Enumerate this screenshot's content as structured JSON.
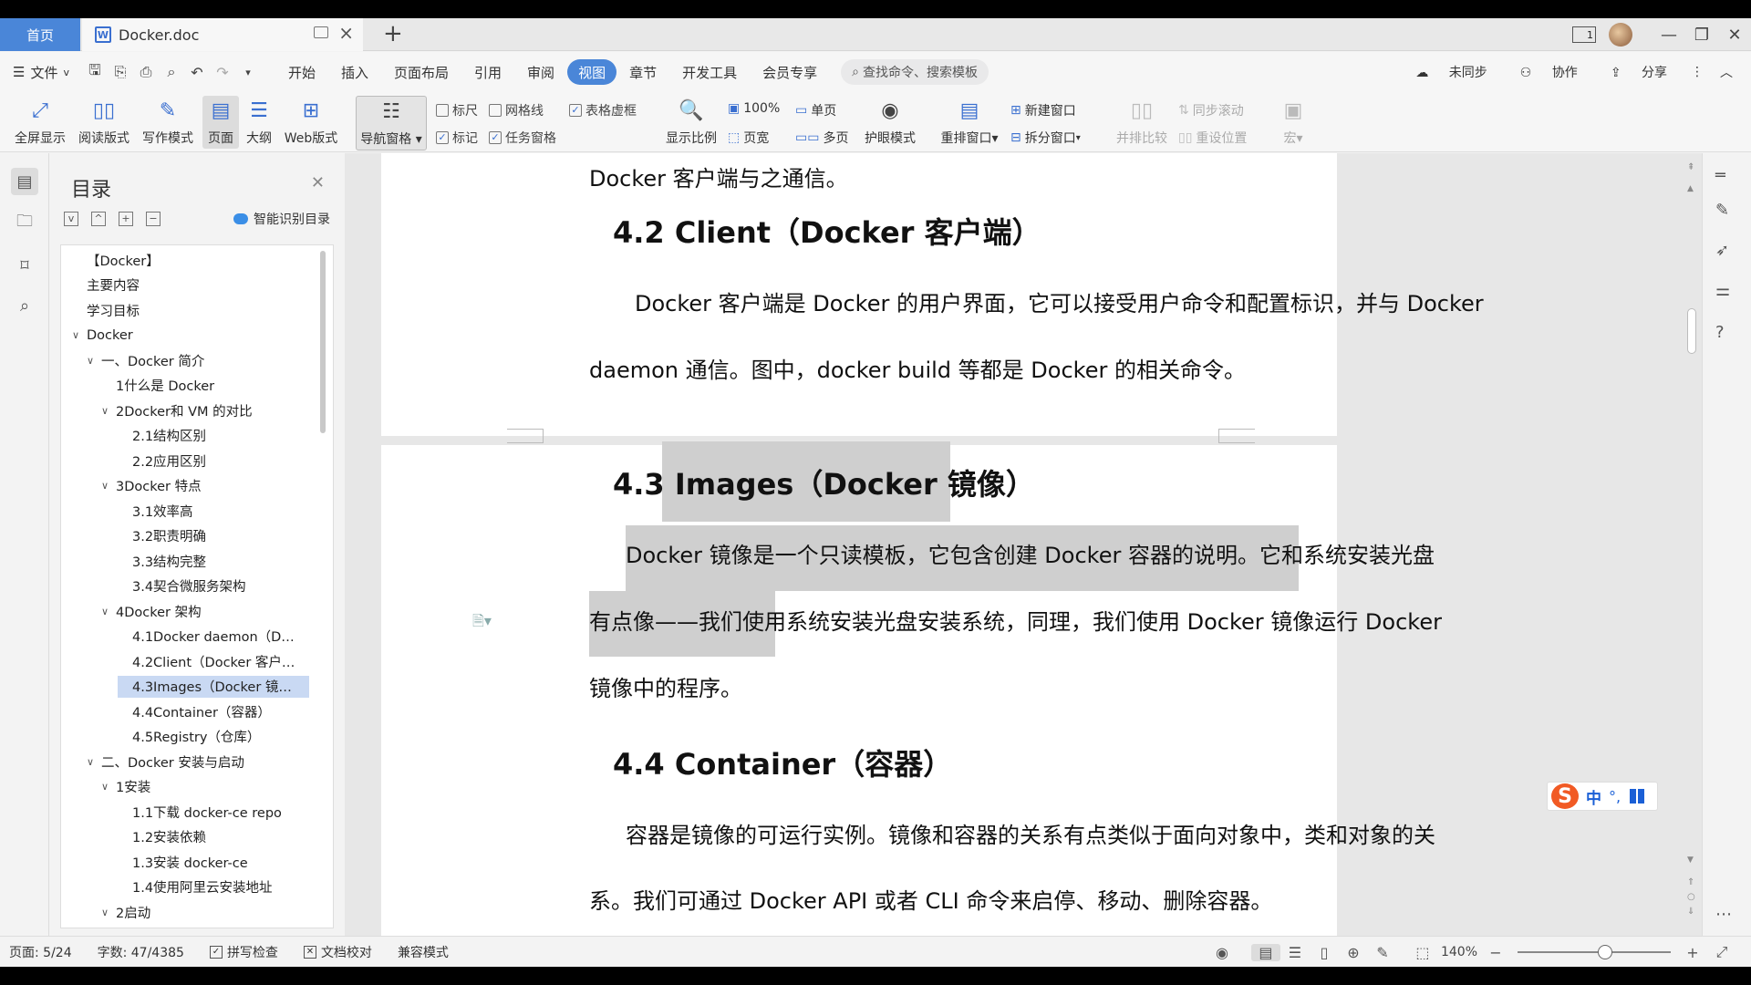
{
  "titlebar": {
    "home_tab": "首页",
    "doc_tab": "Docker.doc",
    "doc_icon": "W",
    "add_tab": "+",
    "page_num": "1"
  },
  "menubar": {
    "file": "文件",
    "items": [
      "开始",
      "插入",
      "页面布局",
      "引用",
      "审阅",
      "视图",
      "章节",
      "开发工具",
      "会员专享"
    ],
    "active": "视图",
    "search": "查找命令、搜索模板",
    "sync": "未同步",
    "collab": "协作",
    "share": "分享"
  },
  "ribbon": {
    "fullscreen": "全屏显示",
    "reading": "阅读版式",
    "writing": "写作模式",
    "page": "页面",
    "outline": "大纲",
    "web": "Web版式",
    "nav_pane": "导航窗格",
    "ruler": "标尺",
    "gridlines": "网格线",
    "table_grid": "表格虚框",
    "marks": "标记",
    "task_pane": "任务窗格",
    "zoom_ratio": "显示比例",
    "zoom_100": "100%",
    "page_width": "页宽",
    "single_page": "单页",
    "multi_page": "多页",
    "eye_protect": "护眼模式",
    "rearrange": "重排窗口",
    "new_window": "新建窗口",
    "split_window": "拆分窗口",
    "side_by_side": "并排比较",
    "sync_scroll": "同步滚动",
    "reset_pos": "重设位置",
    "macro": "宏"
  },
  "toc": {
    "title": "目录",
    "smart": "智能识别目录",
    "items": [
      {
        "text": "【Docker】",
        "level": 0,
        "caret": ""
      },
      {
        "text": "主要内容",
        "level": 0,
        "caret": ""
      },
      {
        "text": "学习目标",
        "level": 0,
        "caret": ""
      },
      {
        "text": "Docker",
        "level": 0,
        "caret": "v"
      },
      {
        "text": "一、Docker 简介",
        "level": 1,
        "caret": "v"
      },
      {
        "text": "1什么是 Docker",
        "level": 2,
        "caret": ""
      },
      {
        "text": "2Docker和 VM 的对比",
        "level": 2,
        "caret": "v"
      },
      {
        "text": "2.1结构区别",
        "level": 3,
        "caret": ""
      },
      {
        "text": "2.2应用区别",
        "level": 3,
        "caret": ""
      },
      {
        "text": "3Docker 特点",
        "level": 2,
        "caret": "v"
      },
      {
        "text": "3.1效率高",
        "level": 3,
        "caret": ""
      },
      {
        "text": "3.2职责明确",
        "level": 3,
        "caret": ""
      },
      {
        "text": "3.3结构完整",
        "level": 3,
        "caret": ""
      },
      {
        "text": "3.4契合微服务架构",
        "level": 3,
        "caret": ""
      },
      {
        "text": "4Docker 架构",
        "level": 2,
        "caret": "v"
      },
      {
        "text": "4.1Docker daemon（D…",
        "level": 3,
        "caret": ""
      },
      {
        "text": "4.2Client（Docker 客户…",
        "level": 3,
        "caret": ""
      },
      {
        "text": "4.3Images（Docker 镜…",
        "level": 3,
        "caret": "",
        "selected": true
      },
      {
        "text": "4.4Container（容器）",
        "level": 3,
        "caret": ""
      },
      {
        "text": "4.5Registry（仓库）",
        "level": 3,
        "caret": ""
      },
      {
        "text": "二、Docker 安装与启动",
        "level": 1,
        "caret": "v"
      },
      {
        "text": "1安装",
        "level": 2,
        "caret": "v"
      },
      {
        "text": "1.1下载 docker-ce repo",
        "level": 3,
        "caret": ""
      },
      {
        "text": "1.2安装依赖",
        "level": 3,
        "caret": ""
      },
      {
        "text": "1.3安装 docker-ce",
        "level": 3,
        "caret": ""
      },
      {
        "text": "1.4使用阿里云安装地址",
        "level": 3,
        "caret": ""
      },
      {
        "text": "2启动",
        "level": 2,
        "caret": "v"
      }
    ]
  },
  "document": {
    "p0": "Docker 客户端与之通信。",
    "h42": "4.2  Client（Docker 客户端）",
    "p42a": "Docker 客户端是 Docker 的用户界面，它可以接受用户命令和配置标识，并与 Docker",
    "p42b": "daemon 通信。图中，docker build 等都是 Docker 的相关命令。",
    "h43": "4.3  Images（Docker 镜像）",
    "p43a": "Docker 镜像是一个只读模板，它包含创建 Docker 容器的说明。它和系统安装光盘",
    "p43b": "有点像——我们使用系统安装光盘安装系统，同理，我们使用 Docker 镜像运行 Docker",
    "p43c": "镜像中的程序。",
    "h44": "4.4  Container（容器）",
    "p44a": "容器是镜像的可运行实例。镜像和容器的关系有点类似于面向对象中，类和对象的关",
    "p44b": "系。我们可通过 Docker API 或者 CLI 命令来启停、移动、删除容器。"
  },
  "ime": {
    "s": "S",
    "lang": "中",
    "punct": "°,"
  },
  "statusbar": {
    "page": "页面: 5/24",
    "words": "字数: 47/4385",
    "spell": "拼写检查",
    "proof": "文档校对",
    "compat": "兼容模式",
    "zoom": "140%",
    "zoom_level_percent": 140,
    "minus": "−",
    "plus": "+"
  },
  "colors": {
    "accent": "#4a86d8",
    "selection": "#c9d9f3",
    "highlight": "#cfcfcf"
  }
}
